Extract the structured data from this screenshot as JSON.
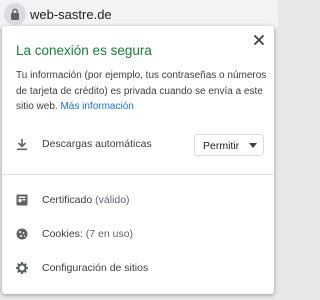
{
  "omnibox": {
    "url": "web-sastre.de",
    "lock_icon": "lock-icon"
  },
  "popup": {
    "title": "La conexión es segura",
    "description": "Tu información (por ejemplo, tus contraseñas o números de tarjeta de crédito) es privada cuando se envía a este sitio web.",
    "more_link": "Más información",
    "close_icon": "close-icon",
    "downloads": {
      "label": "Descargas automáticas",
      "icon": "download-icon",
      "selected": "Permitir"
    },
    "certificate": {
      "label": "Certificado",
      "status": "(válido)",
      "icon": "certificate-icon"
    },
    "cookies": {
      "label": "Cookies:",
      "status": "(7 en uso)",
      "icon": "cookie-icon"
    },
    "site_settings": {
      "label": "Configuración de sitios",
      "icon": "gear-icon"
    },
    "colors": {
      "secure_green": "#188038",
      "link_blue": "#1a73e8"
    }
  }
}
